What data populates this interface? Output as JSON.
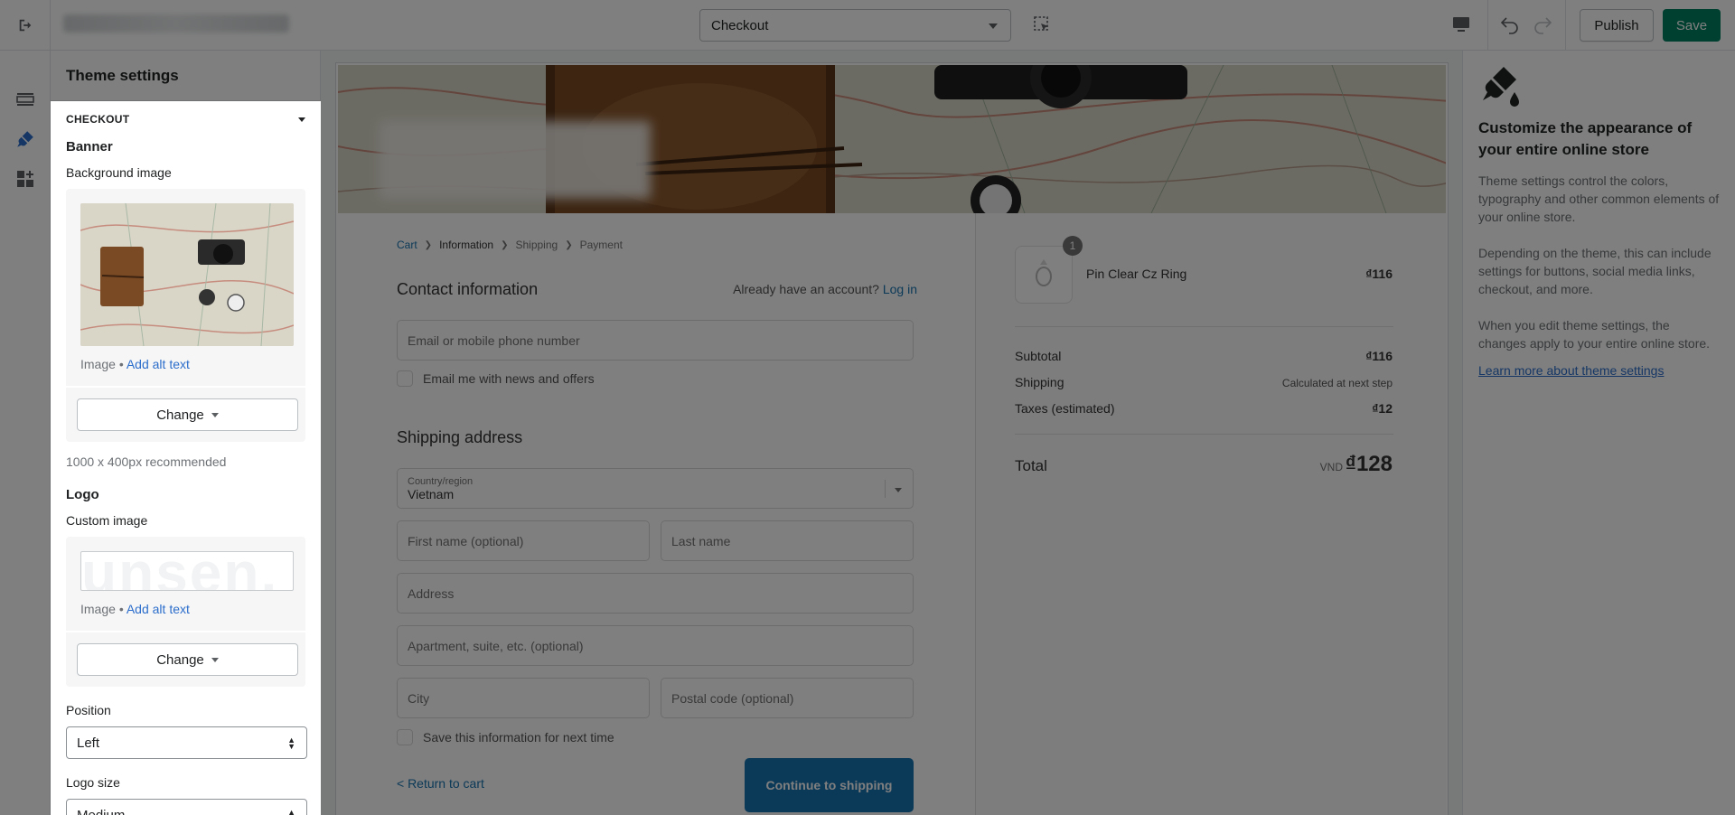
{
  "topbar": {
    "page_select": "Checkout",
    "publish_label": "Publish",
    "save_label": "Save"
  },
  "sidebar": {
    "title": "Theme settings",
    "section_title": "CHECKOUT",
    "banner_heading": "Banner",
    "background_image_label": "Background image",
    "image_word": "Image",
    "bullet": "•",
    "add_alt_text": "Add alt text",
    "change_label": "Change",
    "recommend": "1000 x 400px recommended",
    "logo_heading": "Logo",
    "custom_image_label": "Custom image",
    "position_label": "Position",
    "position_value": "Left",
    "logo_size_label": "Logo size",
    "logo_size_value": "Medium"
  },
  "checkout": {
    "breadcrumb": [
      "Cart",
      "Information",
      "Shipping",
      "Payment"
    ],
    "contact_heading": "Contact information",
    "account_prompt": "Already have an account?",
    "login_link": "Log in",
    "email_placeholder": "Email or mobile phone number",
    "news_checkbox": "Email me with news and offers",
    "shipping_heading": "Shipping address",
    "country_label": "Country/region",
    "country_value": "Vietnam",
    "first_name_placeholder": "First name (optional)",
    "last_name_placeholder": "Last name",
    "address_placeholder": "Address",
    "apartment_placeholder": "Apartment, suite, etc. (optional)",
    "city_placeholder": "City",
    "postal_placeholder": "Postal code (optional)",
    "save_info_checkbox": "Save this information for next time",
    "return_link": "< Return to cart",
    "continue_button": "Continue to shipping"
  },
  "summary": {
    "quantity": "1",
    "product_name": "Pin Clear Cz Ring",
    "product_price": "₫116",
    "subtotal_label": "Subtotal",
    "subtotal_value": "₫116",
    "shipping_label": "Shipping",
    "shipping_value": "Calculated at next step",
    "taxes_label": "Taxes (estimated)",
    "taxes_value": "₫12",
    "total_label": "Total",
    "currency_code": "VND",
    "total_value": "₫128"
  },
  "info_panel": {
    "title": "Customize the appearance of your entire online store",
    "p1": "Theme settings control the colors, typography and other common elements of your online store.",
    "p2": "Depending on the theme, this can include settings for buttons, social media links, checkout, and more.",
    "p3": "When you edit theme settings, the changes apply to your entire online store.",
    "link": "Learn more about theme settings"
  },
  "logo_preview_text": "unsen.",
  "colors": {
    "save_green": "#008060",
    "link_blue": "#2c6ecb",
    "checkout_blue": "#1773b0",
    "overlay": "rgba(0,0,0,0.5)"
  }
}
